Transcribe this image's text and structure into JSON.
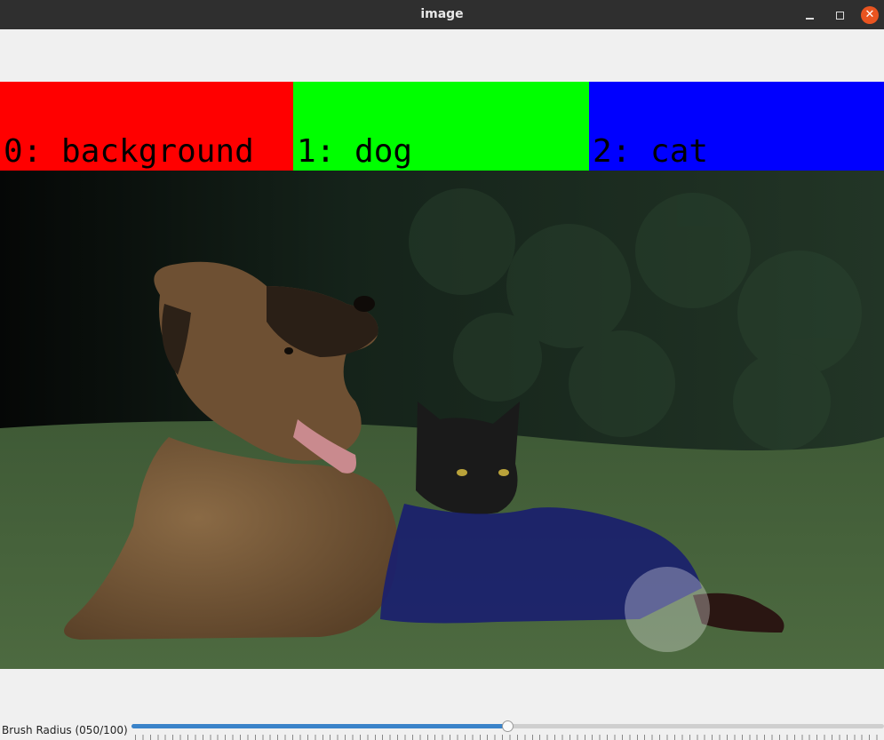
{
  "window": {
    "title": "image",
    "controls": {
      "minimize": "minimize-icon",
      "maximize": "maximize-icon",
      "close": "close-icon"
    }
  },
  "labels": [
    {
      "text": "0: background",
      "color": "#ff0000"
    },
    {
      "text": "1: dog",
      "color": "#00ff00"
    },
    {
      "text": "2: cat",
      "color": "#0000ff"
    }
  ],
  "overlay": {
    "active_class": "2: cat",
    "mask_color": "#1a1f6e"
  },
  "trackbar": {
    "label": "Brush Radius (050/100)",
    "value": 50,
    "max": 100,
    "accent": "#3a83c9"
  }
}
